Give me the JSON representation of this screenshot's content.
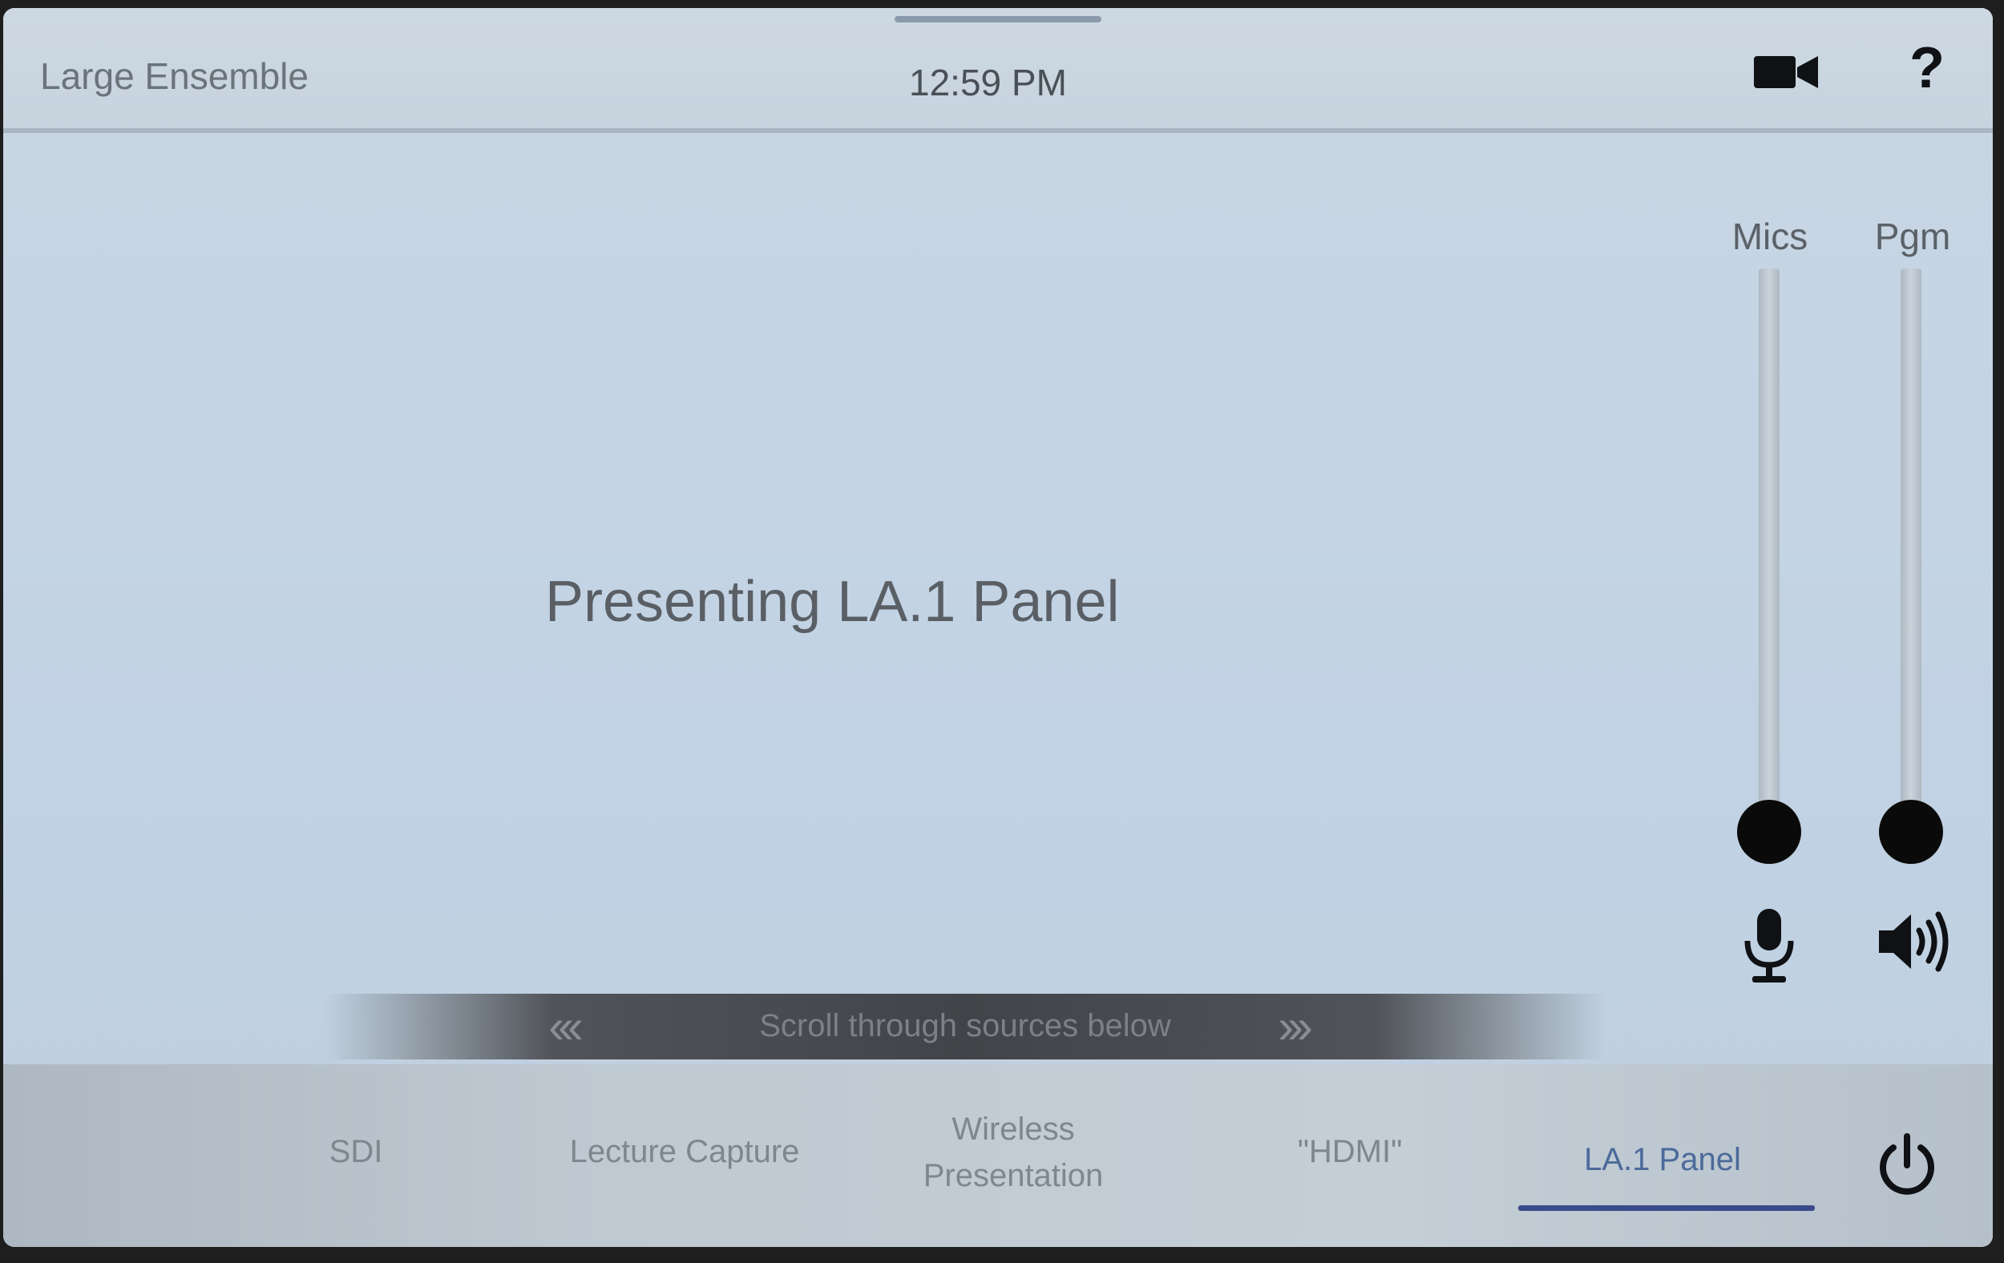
{
  "header": {
    "room_name": "Large Ensemble",
    "time": "12:59 PM",
    "help_label": "?"
  },
  "main": {
    "status": "Presenting LA.1 Panel"
  },
  "audio": {
    "mics_label": "Mics",
    "program_label": "Pgm",
    "mics_level": 0.0,
    "program_level": 0.0
  },
  "scroll_hint": {
    "text": "Scroll through sources below",
    "left_arrows": "‹‹‹",
    "right_arrows": "›››"
  },
  "sources": {
    "items": [
      {
        "label": "SDI"
      },
      {
        "label": "Lecture Capture"
      },
      {
        "label": "Wireless Presentation"
      },
      {
        "label": "\"HDMI\""
      },
      {
        "label": "LA.1 Panel"
      }
    ],
    "selected": "LA.1 Panel"
  },
  "colors": {
    "accent": "#3b4a8a",
    "knob": "#0a0a0a"
  },
  "icons": [
    "video-camera-icon",
    "help-icon",
    "microphone-icon",
    "speaker-icon",
    "power-icon"
  ]
}
